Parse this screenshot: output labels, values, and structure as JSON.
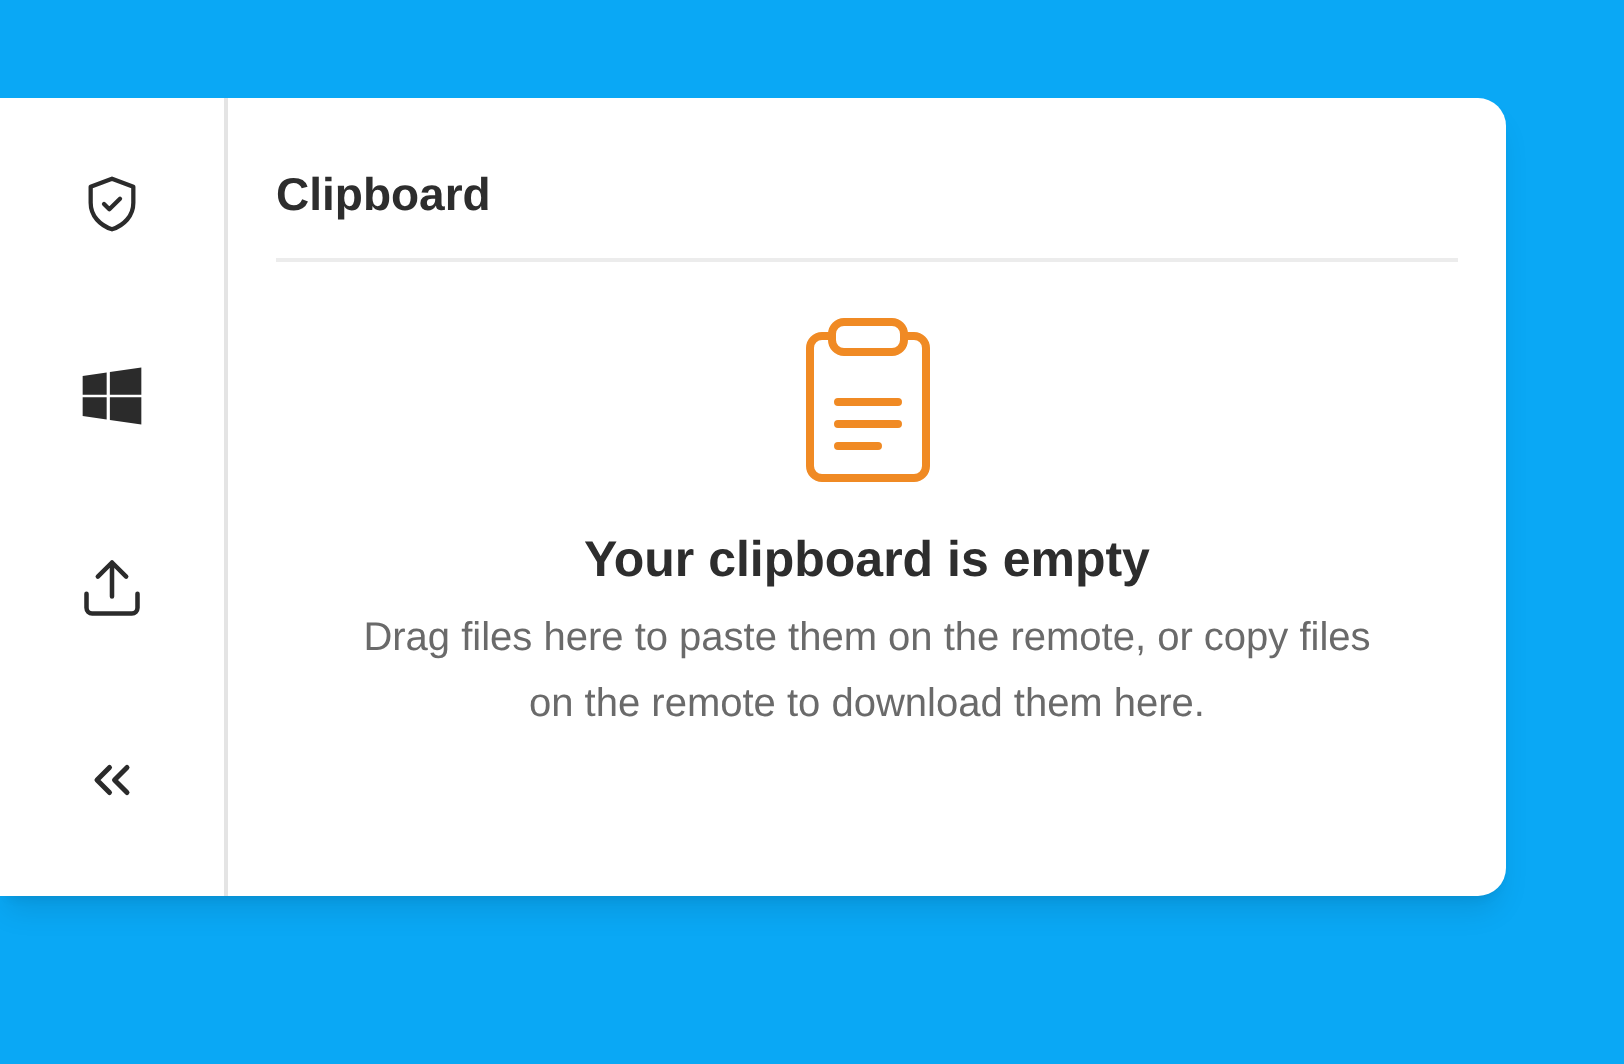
{
  "sidebar": {
    "items": [
      {
        "kind": "shield"
      },
      {
        "kind": "windows"
      },
      {
        "kind": "upload"
      },
      {
        "kind": "collapse"
      }
    ]
  },
  "panel": {
    "title": "Clipboard",
    "empty_state": {
      "heading": "Your clipboard is empty",
      "message": "Drag files here to paste them on the remote, or copy files on the remote to download them here."
    }
  }
}
